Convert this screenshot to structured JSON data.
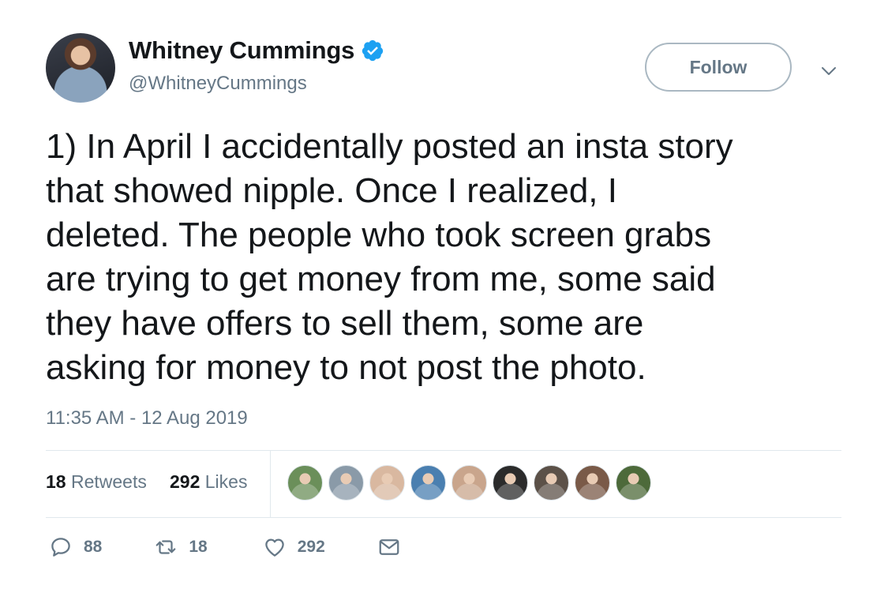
{
  "author": {
    "name": "Whitney Cummings",
    "handle": "@WhitneyCummings",
    "verified": true
  },
  "follow_label": "Follow",
  "tweet": {
    "lines": [
      "1) In April I accidentally posted an insta story",
      "that showed nipple. Once I realized, I",
      "deleted. The people who took screen grabs",
      "are trying to get money from me, some said",
      "they have offers to sell them, some are",
      "asking for money to not post the photo."
    ],
    "timestamp": "11:35 AM - 12 Aug 2019"
  },
  "stats": {
    "retweets_count": "18",
    "retweets_label": "Retweets",
    "likes_count": "292",
    "likes_label": "Likes"
  },
  "likers": [
    {
      "icon": "stadium-avatar",
      "color": "#6b8f5a"
    },
    {
      "icon": "person-avatar",
      "color": "#8a9aa8"
    },
    {
      "icon": "person-avatar",
      "color": "#d9b8a0"
    },
    {
      "icon": "person-avatar",
      "color": "#4a7fb0"
    },
    {
      "icon": "person-avatar",
      "color": "#c9a58c"
    },
    {
      "icon": "person-avatar",
      "color": "#2b2b2b"
    },
    {
      "icon": "animal-avatar",
      "color": "#5c5148"
    },
    {
      "icon": "person-avatar",
      "color": "#7a5a48"
    },
    {
      "icon": "eagle-avatar",
      "color": "#4d6a3a"
    }
  ],
  "actions": {
    "replies": "88",
    "retweets": "18",
    "likes": "292"
  },
  "colors": {
    "text": "#14171a",
    "muted": "#657786",
    "verified_blue": "#1da1f2",
    "border": "#e1e8ed"
  }
}
